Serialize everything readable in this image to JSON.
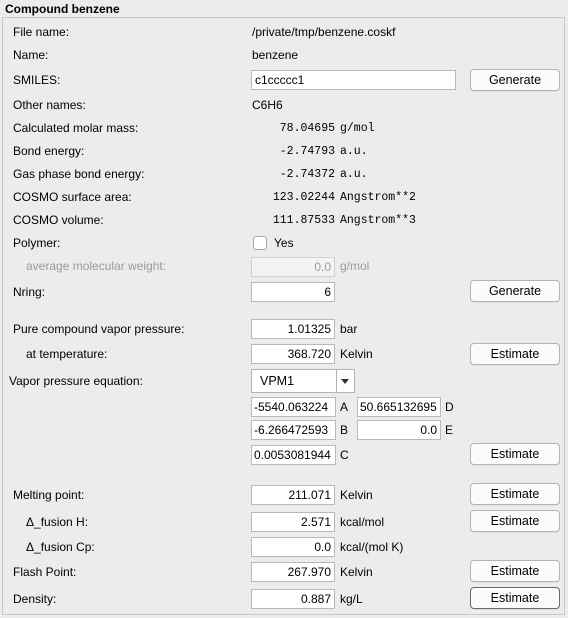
{
  "panel": {
    "title": "Compound benzene"
  },
  "rows": {
    "file_name": {
      "label": "File name:",
      "value": "/private/tmp/benzene.coskf"
    },
    "name": {
      "label": "Name:",
      "value": "benzene"
    },
    "smiles": {
      "label": "SMILES:",
      "value": "c1ccccc1",
      "button": "Generate"
    },
    "other_names": {
      "label": "Other names:",
      "value": "C6H6"
    },
    "molar_mass": {
      "label": "Calculated molar mass:",
      "value": "78.04695",
      "unit": "g/mol"
    },
    "bond_energy": {
      "label": "Bond energy:",
      "value": "-2.74793",
      "unit": "a.u."
    },
    "gas_bond_energy": {
      "label": "Gas phase bond energy:",
      "value": "-2.74372",
      "unit": "a.u."
    },
    "surface_area": {
      "label": "COSMO surface area:",
      "value": "123.02244",
      "unit": "Angstrom**2"
    },
    "volume": {
      "label": "COSMO volume:",
      "value": "111.87533",
      "unit": "Angstrom**3"
    },
    "polymer": {
      "label": "Polymer:",
      "checkbox_label": "Yes",
      "checked": false
    },
    "avg_mw": {
      "label": "average molecular weight:",
      "value": "0.0",
      "unit": "g/mol"
    },
    "nring": {
      "label": "Nring:",
      "value": "6",
      "button": "Generate"
    },
    "vapor_pressure": {
      "label": "Pure compound vapor pressure:",
      "value": "1.01325",
      "unit": "bar"
    },
    "at_temperature": {
      "label": "at temperature:",
      "value": "368.720",
      "unit": "Kelvin",
      "button": "Estimate"
    },
    "vp_equation": {
      "label": "Vapor pressure equation:",
      "selected": "VPM1",
      "A": {
        "value": "-5540.063224",
        "letter": "A"
      },
      "B": {
        "value": "-6.266472593",
        "letter": "B"
      },
      "C": {
        "value": "0.0053081944",
        "letter": "C"
      },
      "D": {
        "value": "50.665132695",
        "letter": "D"
      },
      "E": {
        "value": "0.0",
        "letter": "E"
      },
      "button": "Estimate"
    },
    "melting_point": {
      "label": "Melting point:",
      "value": "211.071",
      "unit": "Kelvin",
      "button": "Estimate"
    },
    "fusion_h": {
      "label": "Δ_fusion H:",
      "value": "2.571",
      "unit": "kcal/mol",
      "button": "Estimate"
    },
    "fusion_cp": {
      "label": "Δ_fusion Cp:",
      "value": "0.0",
      "unit": "kcal/(mol K)"
    },
    "flash_point": {
      "label": "Flash Point:",
      "value": "267.970",
      "unit": "Kelvin",
      "button": "Estimate"
    },
    "density": {
      "label": "Density:",
      "value": "0.887",
      "unit": "kg/L",
      "button": "Estimate"
    }
  }
}
